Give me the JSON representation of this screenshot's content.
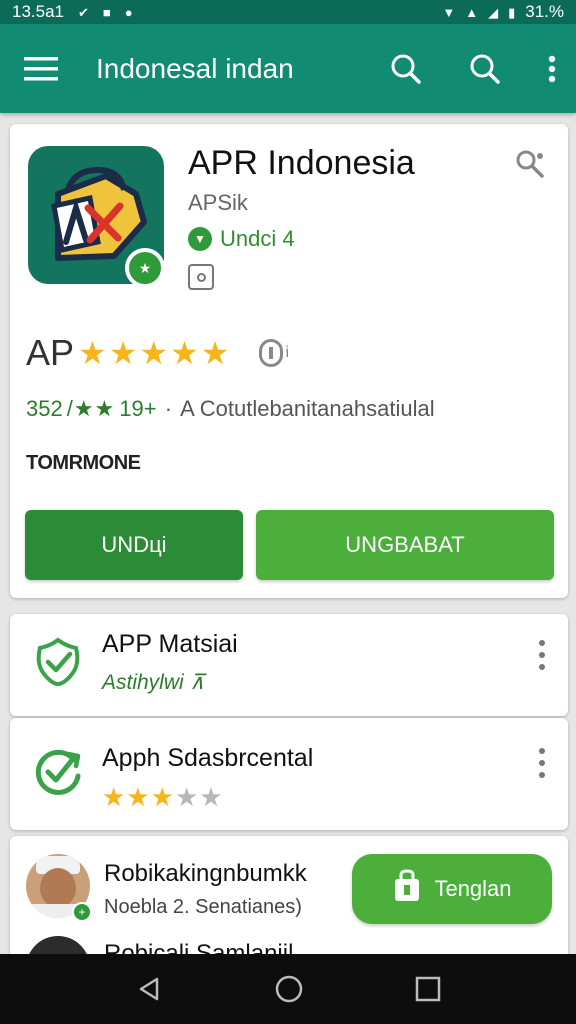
{
  "status_bar": {
    "time": "13.5a1",
    "battery": "31.%"
  },
  "app_bar": {
    "title": "Indonesal indan",
    "icons": [
      "menu-icon",
      "search-icon",
      "search-icon",
      "more-vert-icon"
    ]
  },
  "app": {
    "name": "APR Indonesia",
    "developer": "APSik",
    "badge_text": "Undci 4",
    "rating_label": "AP",
    "rating_stars": 5,
    "rating_extra": "i",
    "review_count": "352",
    "review_mid": "19+",
    "review_text": "A Cotutlebanitanahsatiulal",
    "section_label": "TOMRMONE",
    "primary_button": "UNDці",
    "secondary_button": "UNGBABAT"
  },
  "list": [
    {
      "title": "APP Matsiai",
      "subtitle": "Astihylwi",
      "icon": "shield-check-icon"
    },
    {
      "title": "Apph Sdasbrcental",
      "stars_on": 3,
      "stars_total": 5,
      "icon": "refresh-check-icon"
    }
  ],
  "user": {
    "name": "Robikakingnbumkk",
    "subtitle": "Noebla 2. Senatianes)",
    "button": "Tenglan",
    "second_name": "Robicali Samlaniil"
  },
  "colors": {
    "status_bar": "#0b6b57",
    "app_bar": "#118c72",
    "primary_green": "#2c8c35",
    "light_green": "#4caf3c",
    "star": "#f6b51d"
  }
}
